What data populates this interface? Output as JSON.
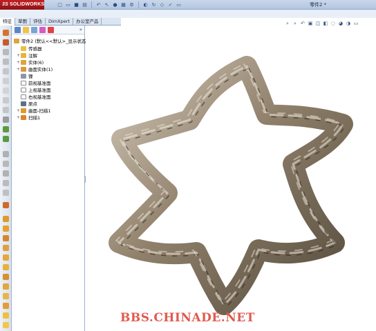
{
  "app": {
    "logo_prefix": "3S",
    "logo_text": "SOLIDWORKS",
    "doc_title": "零件2 *"
  },
  "tabs": [
    {
      "label": "特征"
    },
    {
      "label": "草图"
    },
    {
      "label": "评估"
    },
    {
      "label": "DimXpert"
    },
    {
      "label": "办公室产品"
    }
  ],
  "tree": {
    "root": "零件2 (默认<<默认>_显示状态",
    "items": [
      {
        "label": "传感器",
        "expand": ""
      },
      {
        "label": "注解",
        "expand": "+"
      },
      {
        "label": "实体(6)",
        "expand": "+"
      },
      {
        "label": "曲面实体(1)",
        "expand": "+"
      },
      {
        "label": "镍",
        "expand": ""
      },
      {
        "label": "前视基准面",
        "expand": ""
      },
      {
        "label": "上视基准面",
        "expand": ""
      },
      {
        "label": "右视基准面",
        "expand": ""
      },
      {
        "label": "原点",
        "expand": ""
      },
      {
        "label": "曲面-扫描1",
        "expand": "+"
      },
      {
        "label": "扫描1",
        "expand": "+"
      }
    ],
    "more_glyph": "»"
  },
  "watermark": "BBS.CHINADE.NET",
  "colors": {
    "accent": "#c21e22",
    "panel": "#dbe5f2",
    "rope": "#7d6f5e",
    "watermark": "#e05a4e"
  }
}
